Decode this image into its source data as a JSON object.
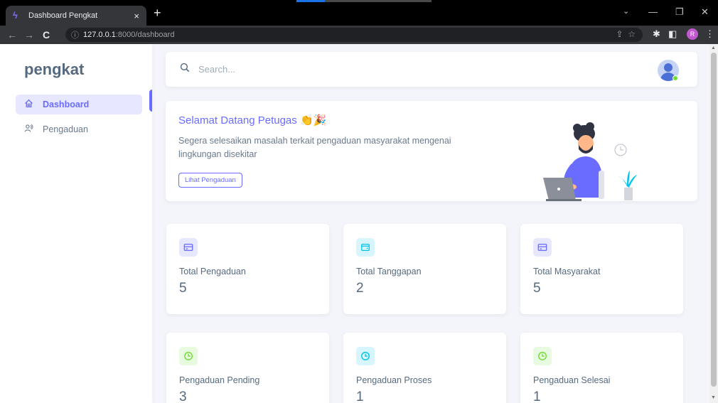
{
  "browser": {
    "tab_title": "Dashboard Pengkat",
    "tab_close": "×",
    "new_tab": "+",
    "url_host": "127.0.0.1",
    "url_path": ":8000/dashboard",
    "profile_initial": "R"
  },
  "sidebar": {
    "brand": "pengkat",
    "items": [
      {
        "label": "Dashboard",
        "icon": "home-icon",
        "active": true
      },
      {
        "label": "Pengaduan",
        "icon": "users-icon",
        "active": false
      }
    ]
  },
  "search": {
    "placeholder": "Search..."
  },
  "welcome": {
    "title": "Selamat Datang Petugas 👏🎉",
    "text": "Segera selesaikan masalah terkait pengaduan masyarakat mengenai lingkungan disekitar",
    "button": "Lihat Pengaduan"
  },
  "stats": [
    {
      "label": "Total Pengaduan",
      "value": "5",
      "icon": "card-icon",
      "color": "#696cff",
      "bg": "#e7e7ff"
    },
    {
      "label": "Total Tanggapan",
      "value": "2",
      "icon": "wallet-icon",
      "color": "#03c3ec",
      "bg": "#d7f5fc"
    },
    {
      "label": "Total Masyarakat",
      "value": "5",
      "icon": "card-icon",
      "color": "#696cff",
      "bg": "#e7e7ff"
    },
    {
      "label": "Pengaduan Pending",
      "value": "3",
      "icon": "clock-icon",
      "color": "#71dd37",
      "bg": "#e8fadf"
    },
    {
      "label": "Pengaduan Proses",
      "value": "1",
      "icon": "clock-icon",
      "color": "#03c3ec",
      "bg": "#d7f5fc"
    },
    {
      "label": "Pengaduan Selesai",
      "value": "1",
      "icon": "clock-icon",
      "color": "#71dd37",
      "bg": "#e8fadf"
    }
  ]
}
